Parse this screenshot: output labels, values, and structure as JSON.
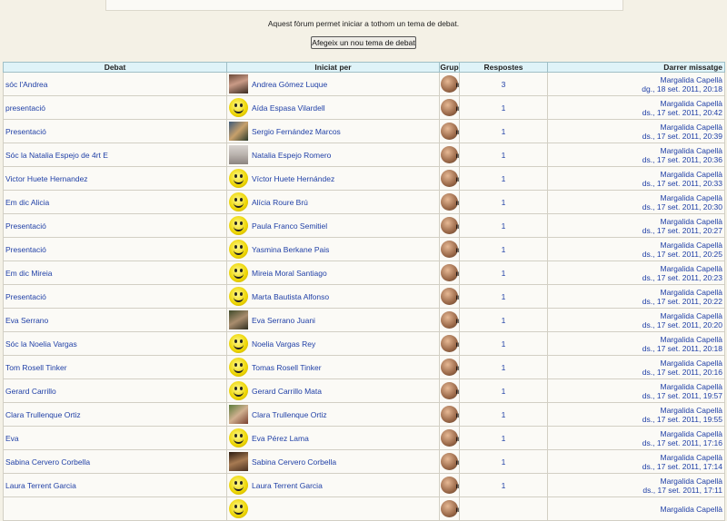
{
  "intro_text": "Aquest fòrum permet iniciar a tothom un tema de debat.",
  "add_button": "Afegeix un nou tema de debat",
  "columns": {
    "debat": "Debat",
    "iniciat": "Iniciat per",
    "grup": "Grup",
    "respostes": "Respostes",
    "darrer": "Darrer missatge"
  },
  "rows": [
    {
      "title": "sóc l'Andrea",
      "user": "Andrea Gómez Luque",
      "avatar": "photo1-avatar",
      "replies": "3",
      "last_user": "Margalida Capellà",
      "last_date": "dg., 18 set. 2011, 20:18"
    },
    {
      "title": "presentació",
      "user": "Aída Espasa Vilardell",
      "avatar": "smiley-avatar",
      "replies": "1",
      "last_user": "Margalida Capellà",
      "last_date": "ds., 17 set. 2011, 20:42"
    },
    {
      "title": "Presentació",
      "user": "Sergio Fernández Marcos",
      "avatar": "photo2-avatar",
      "replies": "1",
      "last_user": "Margalida Capellà",
      "last_date": "ds., 17 set. 2011, 20:39"
    },
    {
      "title": "Sóc la Natalia Espejo de 4rt E",
      "user": "Natalia Espejo Romero",
      "avatar": "photo3-avatar",
      "replies": "1",
      "last_user": "Margalida Capellà",
      "last_date": "ds., 17 set. 2011, 20:36"
    },
    {
      "title": "Victor Huete Hernandez",
      "user": "Víctor Huete Hernández",
      "avatar": "smiley-avatar",
      "replies": "1",
      "last_user": "Margalida Capellà",
      "last_date": "ds., 17 set. 2011, 20:33"
    },
    {
      "title": "Em dic Alicia",
      "user": "Alícia Roure Brú",
      "avatar": "smiley-avatar",
      "replies": "1",
      "last_user": "Margalida Capellà",
      "last_date": "ds., 17 set. 2011, 20:30"
    },
    {
      "title": "Presentació",
      "user": "Paula Franco Semitiel",
      "avatar": "smiley-avatar",
      "replies": "1",
      "last_user": "Margalida Capellà",
      "last_date": "ds., 17 set. 2011, 20:27"
    },
    {
      "title": "Presentació",
      "user": "Yasmina Berkane Pais",
      "avatar": "smiley-avatar",
      "replies": "1",
      "last_user": "Margalida Capellà",
      "last_date": "ds., 17 set. 2011, 20:25"
    },
    {
      "title": "Em dic Mireia",
      "user": "Mireia Moral Santiago",
      "avatar": "smiley-avatar",
      "replies": "1",
      "last_user": "Margalida Capellà",
      "last_date": "ds., 17 set. 2011, 20:23"
    },
    {
      "title": "Presentació",
      "user": "Marta Bautista Alfonso",
      "avatar": "smiley-avatar",
      "replies": "1",
      "last_user": "Margalida Capellà",
      "last_date": "ds., 17 set. 2011, 20:22"
    },
    {
      "title": "Eva Serrano",
      "user": "Eva Serrano Juani",
      "avatar": "photo4-avatar",
      "replies": "1",
      "last_user": "Margalida Capellà",
      "last_date": "ds., 17 set. 2011, 20:20"
    },
    {
      "title": "Sóc la Noelia Vargas",
      "user": "Noelia Vargas Rey",
      "avatar": "smiley-avatar",
      "replies": "1",
      "last_user": "Margalida Capellà",
      "last_date": "ds., 17 set. 2011, 20:18"
    },
    {
      "title": "Tom Rosell Tinker",
      "user": "Tomas Rosell Tinker",
      "avatar": "smiley-avatar",
      "replies": "1",
      "last_user": "Margalida Capellà",
      "last_date": "ds., 17 set. 2011, 20:16"
    },
    {
      "title": "Gerard Carrillo",
      "user": "Gerard Carrillo Mata",
      "avatar": "smiley-avatar",
      "replies": "1",
      "last_user": "Margalida Capellà",
      "last_date": "ds., 17 set. 2011, 19:57"
    },
    {
      "title": "Clara Trullenque Ortiz",
      "user": "Clara Trullenque Ortiz",
      "avatar": "photo5-avatar",
      "replies": "1",
      "last_user": "Margalida Capellà",
      "last_date": "ds., 17 set. 2011, 19:55"
    },
    {
      "title": "Eva",
      "user": "Eva Pérez Lama",
      "avatar": "smiley-avatar",
      "replies": "1",
      "last_user": "Margalida Capellà",
      "last_date": "ds., 17 set. 2011, 17:16"
    },
    {
      "title": "Sabina Cervero Corbella",
      "user": "Sabina Cervero Corbella",
      "avatar": "photo6-avatar",
      "replies": "1",
      "last_user": "Margalida Capellà",
      "last_date": "ds., 17 set. 2011, 17:14"
    },
    {
      "title": "Laura Terrent Garcia",
      "user": "Laura Terrent Garcia",
      "avatar": "smiley-avatar",
      "replies": "1",
      "last_user": "Margalida Capellà",
      "last_date": "ds., 17 set. 2011, 17:11"
    },
    {
      "title": "",
      "user": "",
      "avatar": "smiley-avatar",
      "replies": "",
      "last_user": "Margalida Capellà",
      "last_date": ""
    }
  ]
}
